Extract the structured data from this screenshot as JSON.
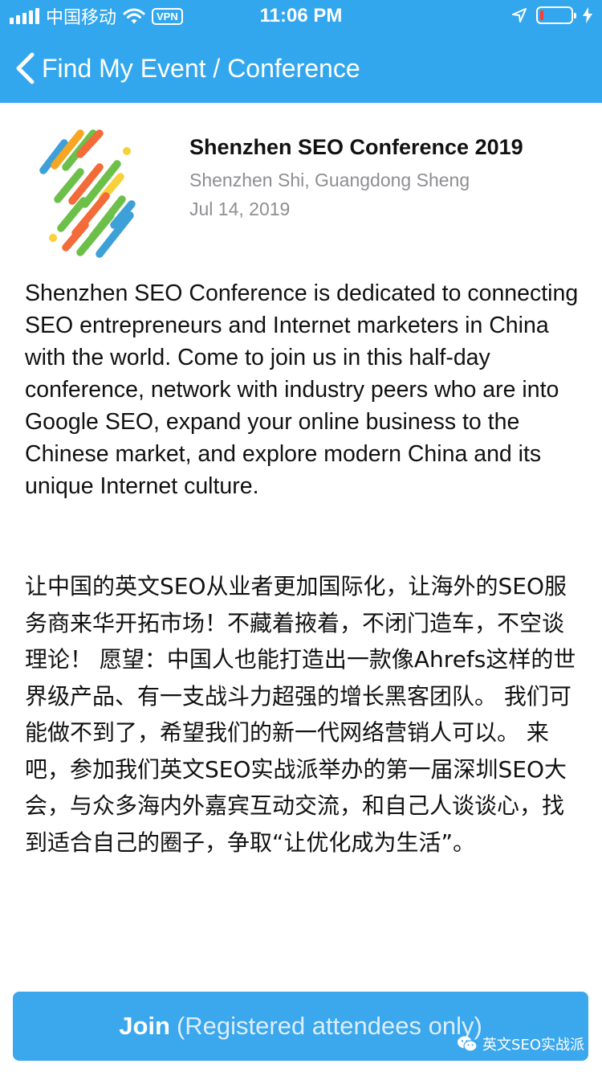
{
  "status_bar": {
    "carrier": "中国移动",
    "vpn": "VPN",
    "time": "11:06 PM"
  },
  "nav": {
    "title": "Find My Event / Conference",
    "back_icon": "chevron-left-icon"
  },
  "event": {
    "title": "Shenzhen SEO Conference 2019",
    "location": "Shenzhen Shi, Guangdong Sheng",
    "date": "Jul 14, 2019",
    "description_en": "Shenzhen SEO Conference is dedicated to connecting SEO entrepreneurs and Internet marketers in China with the world. Come to join us in this half-day conference, network with industry peers who are into Google SEO, expand your online business to the Chinese market, and explore modern China and its unique Internet culture.",
    "description_cn": "让中国的英文SEO从业者更加国际化，让海外的SEO服务商来华开拓市场！不藏着掖着，不闭门造车，不空谈理论！ 愿望：中国人也能打造出一款像Ahrefs这样的世界级产品、有一支战斗力超强的增长黑客团队。 我们可能做不到了，希望我们的新一代网络营销人可以。 来吧，参加我们英文SEO实战派举办的第一届深圳SEO大会，与众多海内外嘉宾互动交流，和自己人谈谈心，找到适合自己的圈子，争取“让优化成为生活”。"
  },
  "join_button": {
    "label": "Join",
    "sublabel": "(Registered attendees only)"
  },
  "watermark": {
    "text": "英文SEO实战派"
  },
  "colors": {
    "header": "#32a7ee",
    "button": "#3ba7ec",
    "secondary_text": "#8e8e93",
    "battery_low": "#ff3b30"
  }
}
